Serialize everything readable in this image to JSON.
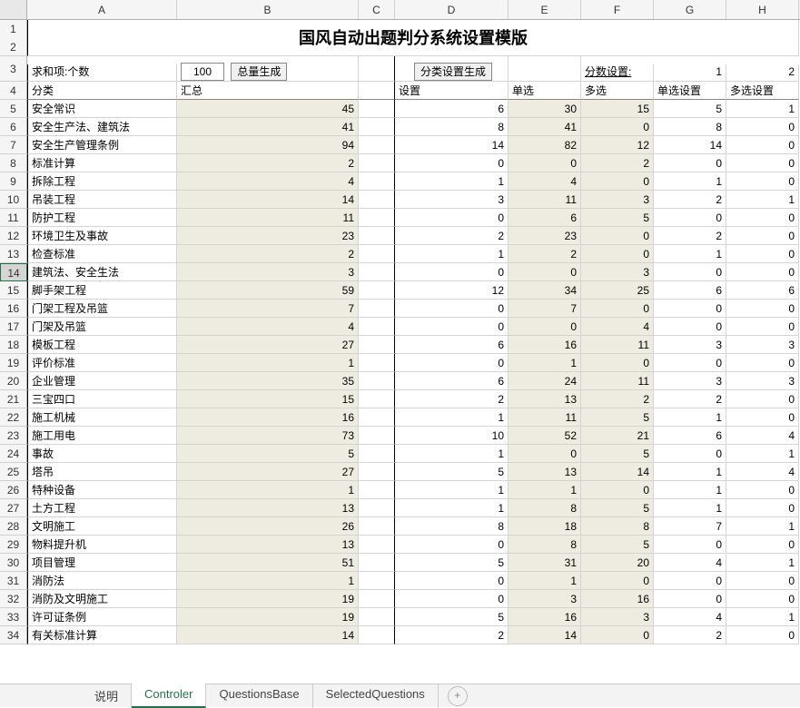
{
  "title": "国风自动出题判分系统设置模版",
  "columns": [
    "A",
    "B",
    "C",
    "D",
    "E",
    "F",
    "G",
    "H"
  ],
  "row3": {
    "label_a": "求和项:个数",
    "input_value": "100",
    "btn1": "总量生成",
    "btn2": "分类设置生成",
    "score_label": "分数设置:",
    "g": "1",
    "h": "2"
  },
  "header_row": {
    "a": "分类",
    "b": "汇总",
    "d": "设置",
    "e": "单选",
    "f": "多选",
    "g": "单选设置",
    "h": "多选设置"
  },
  "rows": [
    {
      "n": 5,
      "a": "安全常识",
      "b": "45",
      "d": "6",
      "e": "30",
      "f": "15",
      "g": "5",
      "h": "1"
    },
    {
      "n": 6,
      "a": "安全生产法、建筑法",
      "b": "41",
      "d": "8",
      "e": "41",
      "f": "0",
      "g": "8",
      "h": "0"
    },
    {
      "n": 7,
      "a": "安全生产管理条例",
      "b": "94",
      "d": "14",
      "e": "82",
      "f": "12",
      "g": "14",
      "h": "0"
    },
    {
      "n": 8,
      "a": "标准计算",
      "b": "2",
      "d": "0",
      "e": "0",
      "f": "2",
      "g": "0",
      "h": "0"
    },
    {
      "n": 9,
      "a": "拆除工程",
      "b": "4",
      "d": "1",
      "e": "4",
      "f": "0",
      "g": "1",
      "h": "0"
    },
    {
      "n": 10,
      "a": "吊装工程",
      "b": "14",
      "d": "3",
      "e": "11",
      "f": "3",
      "g": "2",
      "h": "1"
    },
    {
      "n": 11,
      "a": "防护工程",
      "b": "11",
      "d": "0",
      "e": "6",
      "f": "5",
      "g": "0",
      "h": "0"
    },
    {
      "n": 12,
      "a": "环境卫生及事故",
      "b": "23",
      "d": "2",
      "e": "23",
      "f": "0",
      "g": "2",
      "h": "0"
    },
    {
      "n": 13,
      "a": "检查标准",
      "b": "2",
      "d": "1",
      "e": "2",
      "f": "0",
      "g": "1",
      "h": "0"
    },
    {
      "n": 14,
      "a": "建筑法、安全生法",
      "b": "3",
      "d": "0",
      "e": "0",
      "f": "3",
      "g": "0",
      "h": "0",
      "sel": true
    },
    {
      "n": 15,
      "a": "脚手架工程",
      "b": "59",
      "d": "12",
      "e": "34",
      "f": "25",
      "g": "6",
      "h": "6"
    },
    {
      "n": 16,
      "a": "门架工程及吊篮",
      "b": "7",
      "d": "0",
      "e": "7",
      "f": "0",
      "g": "0",
      "h": "0"
    },
    {
      "n": 17,
      "a": "门架及吊篮",
      "b": "4",
      "d": "0",
      "e": "0",
      "f": "4",
      "g": "0",
      "h": "0"
    },
    {
      "n": 18,
      "a": "模板工程",
      "b": "27",
      "d": "6",
      "e": "16",
      "f": "11",
      "g": "3",
      "h": "3"
    },
    {
      "n": 19,
      "a": "评价标准",
      "b": "1",
      "d": "0",
      "e": "1",
      "f": "0",
      "g": "0",
      "h": "0"
    },
    {
      "n": 20,
      "a": "企业管理",
      "b": "35",
      "d": "6",
      "e": "24",
      "f": "11",
      "g": "3",
      "h": "3"
    },
    {
      "n": 21,
      "a": "三宝四口",
      "b": "15",
      "d": "2",
      "e": "13",
      "f": "2",
      "g": "2",
      "h": "0"
    },
    {
      "n": 22,
      "a": "施工机械",
      "b": "16",
      "d": "1",
      "e": "11",
      "f": "5",
      "g": "1",
      "h": "0"
    },
    {
      "n": 23,
      "a": "施工用电",
      "b": "73",
      "d": "10",
      "e": "52",
      "f": "21",
      "g": "6",
      "h": "4"
    },
    {
      "n": 24,
      "a": "事故",
      "b": "5",
      "d": "1",
      "e": "0",
      "f": "5",
      "g": "0",
      "h": "1"
    },
    {
      "n": 25,
      "a": "塔吊",
      "b": "27",
      "d": "5",
      "e": "13",
      "f": "14",
      "g": "1",
      "h": "4"
    },
    {
      "n": 26,
      "a": "特种设备",
      "b": "1",
      "d": "1",
      "e": "1",
      "f": "0",
      "g": "1",
      "h": "0"
    },
    {
      "n": 27,
      "a": "土方工程",
      "b": "13",
      "d": "1",
      "e": "8",
      "f": "5",
      "g": "1",
      "h": "0"
    },
    {
      "n": 28,
      "a": "文明施工",
      "b": "26",
      "d": "8",
      "e": "18",
      "f": "8",
      "g": "7",
      "h": "1"
    },
    {
      "n": 29,
      "a": "物料提升机",
      "b": "13",
      "d": "0",
      "e": "8",
      "f": "5",
      "g": "0",
      "h": "0"
    },
    {
      "n": 30,
      "a": "项目管理",
      "b": "51",
      "d": "5",
      "e": "31",
      "f": "20",
      "g": "4",
      "h": "1"
    },
    {
      "n": 31,
      "a": "消防法",
      "b": "1",
      "d": "0",
      "e": "1",
      "f": "0",
      "g": "0",
      "h": "0"
    },
    {
      "n": 32,
      "a": "消防及文明施工",
      "b": "19",
      "d": "0",
      "e": "3",
      "f": "16",
      "g": "0",
      "h": "0"
    },
    {
      "n": 33,
      "a": "许可证条例",
      "b": "19",
      "d": "5",
      "e": "16",
      "f": "3",
      "g": "4",
      "h": "1"
    },
    {
      "n": 34,
      "a": "有关标准计算",
      "b": "14",
      "d": "2",
      "e": "14",
      "f": "0",
      "g": "2",
      "h": "0"
    }
  ],
  "tabs": {
    "items": [
      "说明",
      "Controler",
      "QuestionsBase",
      "SelectedQuestions"
    ],
    "active": 1
  }
}
